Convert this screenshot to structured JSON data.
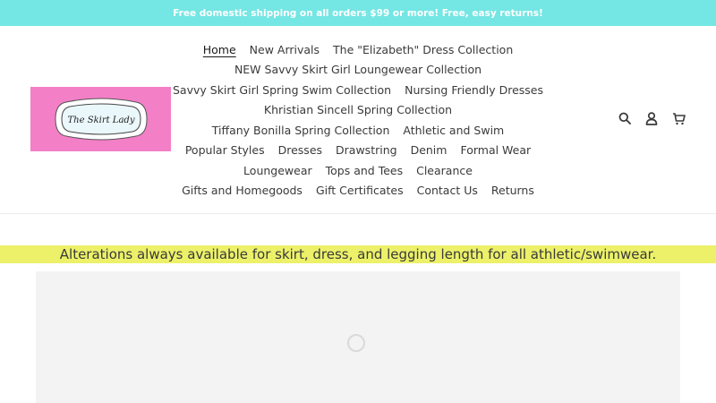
{
  "announcement": {
    "text": "Free domestic shipping on all orders $99 or more! Free, easy returns!"
  },
  "logo": {
    "text": "The Skirt Lady",
    "bg_color": "#f37fc7"
  },
  "nav": {
    "rows": [
      [
        {
          "label": "Home",
          "active": true
        },
        {
          "label": "New Arrivals"
        },
        {
          "label": "The \"Elizabeth\" Dress Collection"
        }
      ],
      [
        {
          "label": "NEW Savvy Skirt Girl Loungewear Collection"
        }
      ],
      [
        {
          "label": "Savvy Skirt Girl Spring Swim Collection"
        },
        {
          "label": "Nursing Friendly Dresses"
        }
      ],
      [
        {
          "label": "Khristian Sincell Spring Collection"
        }
      ],
      [
        {
          "label": "Tiffany Bonilla Spring Collection"
        },
        {
          "label": "Athletic and Swim"
        }
      ],
      [
        {
          "label": "Popular Styles"
        },
        {
          "label": "Dresses"
        },
        {
          "label": "Drawstring"
        },
        {
          "label": "Denim"
        },
        {
          "label": "Formal Wear"
        }
      ],
      [
        {
          "label": "Loungewear"
        },
        {
          "label": "Tops and Tees"
        },
        {
          "label": "Clearance"
        }
      ],
      [
        {
          "label": "Gifts and Homegoods"
        },
        {
          "label": "Gift Certificates"
        },
        {
          "label": "Contact Us"
        },
        {
          "label": "Returns"
        }
      ]
    ]
  },
  "header_icons": [
    "search-icon",
    "account-icon",
    "cart-icon"
  ],
  "alterations_banner": {
    "text": "Alterations always available for skirt, dress, and legging length for all athletic/swimwear.",
    "bg_color": "#ecf169"
  },
  "colors": {
    "announcement_bg": "#74e6e3",
    "slideshow_bg": "#f3f3f3"
  }
}
